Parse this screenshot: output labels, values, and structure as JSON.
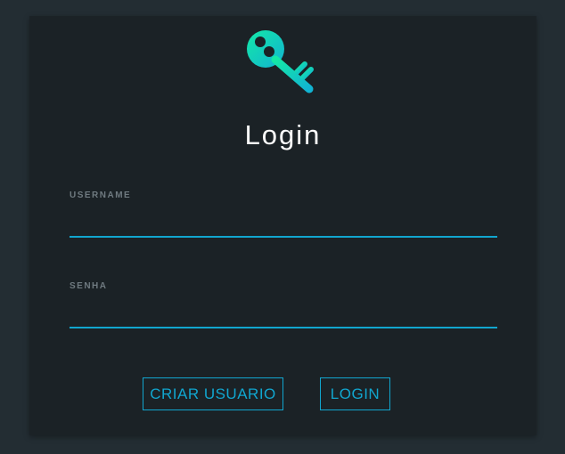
{
  "login_form": {
    "title": "Login",
    "username_label": "USERNAME",
    "username_value": "",
    "password_label": "SENHA",
    "password_value": "",
    "create_user_button": "CRIAR USUARIO",
    "login_button": "LOGIN",
    "icon": "key-icon"
  },
  "colors": {
    "page_background": "#232d33",
    "card_background": "#1b2226",
    "accent": "#11a6cf",
    "icon_gradient_start": "#14e8a6",
    "icon_gradient_end": "#11b4d2"
  }
}
